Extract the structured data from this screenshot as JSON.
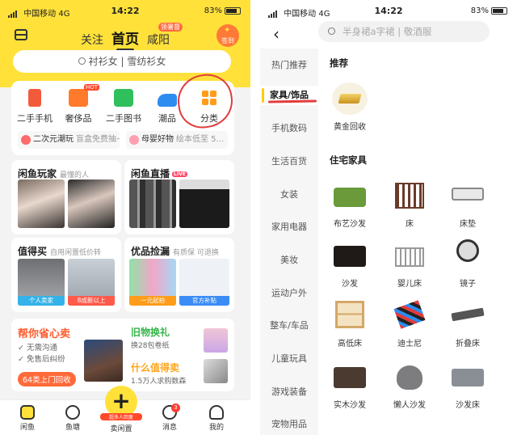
{
  "left": {
    "status": {
      "carrier": "中国移动",
      "network": "4G",
      "time": "14:22",
      "battery": "83%"
    },
    "tabs": [
      {
        "label": "关注"
      },
      {
        "label": "首页",
        "active": true
      },
      {
        "label": "咸阳"
      }
    ],
    "city_badge": "领暑督",
    "sign_label": "签到",
    "search_placeholder": "衬衫女 | 雪纺衫女",
    "categories": [
      {
        "label": "二手手机",
        "icon": "phone-icon",
        "color": "#f25a3c"
      },
      {
        "label": "奢侈品",
        "icon": "bag-icon",
        "color": "#ff7a2a",
        "tag": "HOT"
      },
      {
        "label": "二手图书",
        "icon": "book-icon",
        "color": "#2fbf5c"
      },
      {
        "label": "潮品",
        "icon": "sneaker-icon",
        "color": "#2d8cf0"
      },
      {
        "label": "分类",
        "icon": "grid-icon",
        "color": "#ff9d1a"
      }
    ],
    "promos": [
      {
        "title": "二次元潮玩",
        "sub": "盲盒免费抽~"
      },
      {
        "title": "母婴好物",
        "sub": "绘本低至 5..."
      }
    ],
    "features": {
      "players": {
        "title": "闲鱼玩家",
        "sub": "最懂的人"
      },
      "live": {
        "title": "闲鱼直播",
        "tag": "LIVE"
      },
      "worth_buy": {
        "title": "值得买",
        "sub": "自用闲置低价转",
        "tags": [
          "个人卖家",
          "8成新以上"
        ]
      },
      "quality": {
        "title": "优品捡漏",
        "sub": "有质保 可退换",
        "tags": [
          "一元起拍",
          "官方补贴"
        ]
      }
    },
    "help_sell": {
      "title": "帮你省心卖",
      "points": [
        "✓ 无需沟通",
        "✓ 免售后纠纷"
      ],
      "button": "64类上门回收"
    },
    "old_exchange": {
      "title": "旧物换礼",
      "sub": "换28包卷纸"
    },
    "worth_sell": {
      "title": "什么值得卖",
      "sub": "1.5万人求购数森"
    },
    "nav": [
      {
        "label": "闲鱼",
        "active": true,
        "icon": "home-icon"
      },
      {
        "label": "鱼塘",
        "icon": "pond-icon"
      },
      {
        "label": "卖闲置",
        "icon": "plus-icon",
        "tag": "超多人回复"
      },
      {
        "label": "消息",
        "icon": "message-icon",
        "badge": "3"
      },
      {
        "label": "我的",
        "icon": "user-icon"
      }
    ]
  },
  "right": {
    "status": {
      "carrier": "中国移动",
      "network": "4G",
      "time": "14:22",
      "battery": "83%"
    },
    "search_placeholder": "半身裙a字裙 | 敬酒服",
    "sidebar": [
      {
        "label": "热门推荐"
      },
      {
        "label": "家具/饰品",
        "active": true
      },
      {
        "label": "手机数码"
      },
      {
        "label": "生活百货"
      },
      {
        "label": "女装"
      },
      {
        "label": "家用电器"
      },
      {
        "label": "美妆"
      },
      {
        "label": "运动户外"
      },
      {
        "label": "整车/车品"
      },
      {
        "label": "儿童玩具"
      },
      {
        "label": "游戏装备"
      },
      {
        "label": "宠物用品"
      }
    ],
    "recommend": {
      "title": "推荐",
      "items": [
        {
          "label": "黄金回收",
          "icon": "gold-icon"
        }
      ]
    },
    "home_furniture": {
      "title": "住宅家具",
      "items": [
        {
          "label": "布艺沙发",
          "icon": "sofa-icon"
        },
        {
          "label": "床",
          "icon": "bed-icon"
        },
        {
          "label": "床垫",
          "icon": "mattress-icon"
        },
        {
          "label": "沙发",
          "icon": "leather-sofa-icon"
        },
        {
          "label": "婴儿床",
          "icon": "crib-icon"
        },
        {
          "label": "镜子",
          "icon": "mirror-icon"
        },
        {
          "label": "高低床",
          "icon": "bunk-bed-icon"
        },
        {
          "label": "迪士尼",
          "icon": "disney-icon"
        },
        {
          "label": "折叠床",
          "icon": "folding-bed-icon"
        },
        {
          "label": "实木沙发",
          "icon": "wood-sofa-icon"
        },
        {
          "label": "懒人沙发",
          "icon": "beanbag-icon"
        },
        {
          "label": "沙发床",
          "icon": "sofa-bed-icon"
        }
      ]
    }
  }
}
